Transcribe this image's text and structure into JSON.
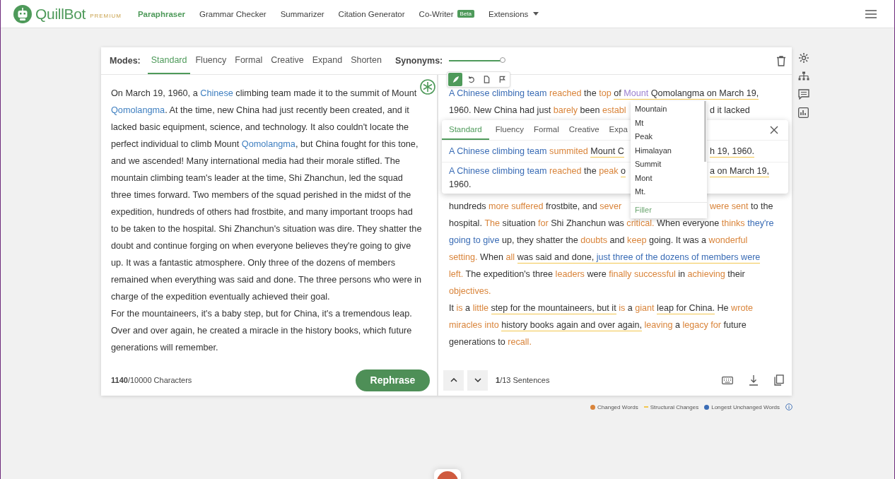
{
  "nav": {
    "brand": "QuillBot",
    "tier": "PREMIUM",
    "links": [
      {
        "label": "Paraphraser",
        "selected": true,
        "kind": "link"
      },
      {
        "label": "Grammar Checker",
        "selected": false,
        "kind": "link"
      },
      {
        "label": "Summarizer",
        "selected": false,
        "kind": "link"
      },
      {
        "label": "Citation Generator",
        "selected": false,
        "kind": "link"
      },
      {
        "label": "Co-Writer",
        "selected": false,
        "kind": "link",
        "badge": "Beta"
      },
      {
        "label": "Extensions",
        "selected": false,
        "kind": "menu"
      }
    ]
  },
  "modes": {
    "label": "Modes:",
    "tabs": [
      {
        "label": "Standard",
        "selected": true
      },
      {
        "label": "Fluency",
        "selected": false
      },
      {
        "label": "Formal",
        "selected": false
      },
      {
        "label": "Creative",
        "selected": false
      },
      {
        "label": "Expand",
        "selected": false
      },
      {
        "label": "Shorten",
        "selected": false
      }
    ]
  },
  "synonyms": {
    "label": "Synonyms:",
    "level": 1
  },
  "input": {
    "paragraphs": [
      [
        {
          "text": "On March 19, 1960, a ",
          "kind": "plain"
        },
        {
          "text": "Chinese",
          "kind": "frozen"
        },
        {
          "text": " climbing team made it to the summit of Mount ",
          "kind": "plain"
        },
        {
          "text": "Qomolangma",
          "kind": "frozen"
        },
        {
          "text": ". At the time, new China had just recently been created, and it lacked basic equipment, science, and technology. It also couldn't locate the perfect individual to climb Mount ",
          "kind": "plain"
        },
        {
          "text": "Qomolangma",
          "kind": "frozen"
        },
        {
          "text": ", but China fought for this tone, and we ascended! Many international media had their morale stifled. The mountain climbing team's leader at the time, Shi Zhanchun, led the squad three times forward. Two members of the squad perished in the midst of the expedition, hundreds of others had frostbite, and many important troops had to be taken to the hospital. Shi Zhanchun's situation was dire. They shatter the doubt and continue forging on when everyone believes they're going to give up. It was a fantastic atmosphere. Only three of the dozens of members remained when everything was said and done. The three persons who were in charge of the expedition eventually achieved their goal.",
          "kind": "plain"
        }
      ],
      [
        {
          "text": "For the mountaineers, it's a baby step, but for China, it's a tremendous leap. Over and over again, he created a miracle in the history books, which future generations will remember.",
          "kind": "plain"
        }
      ]
    ],
    "count": "**1140**/10000 Characters",
    "button": "Rephrase"
  },
  "toolbar": [
    {
      "kind": "quill",
      "selected": true
    },
    {
      "kind": "undo",
      "selected": false
    },
    {
      "kind": "copy",
      "selected": false
    },
    {
      "kind": "flag",
      "selected": false
    }
  ],
  "output": {
    "lines_top": [
      {
        "segments": [
          {
            "text": "A Chinese climbing team",
            "kind": "unchanged",
            "underline": false
          },
          {
            "text": " reached",
            "kind": "changed",
            "underline": false
          },
          {
            "text": " the ",
            "kind": "plain",
            "underline": false
          },
          {
            "text": "top ",
            "kind": "changed",
            "underline": false
          },
          {
            "text": "of ",
            "kind": "plain",
            "underline": true
          },
          {
            "text": "Mount",
            "kind": "active",
            "underline": true
          },
          {
            "text": " Qomolangma on March 19,",
            "kind": "plain",
            "underline": true
          }
        ]
      },
      {
        "segments": [
          {
            "text": "1960. New China had just ",
            "kind": "plain",
            "underline": false
          },
          {
            "text": "barely",
            "kind": "changed",
            "underline": false
          },
          {
            "text": " been ",
            "kind": "plain",
            "underline": false
          },
          {
            "text": "establ",
            "kind": "changed",
            "underline": false
          }
        ],
        "after_gap": [
          {
            "text": "d it lacked",
            "kind": "plain",
            "underline": false
          }
        ]
      }
    ],
    "lines_bottom": [
      {
        "segments": [
          {
            "text": "hundreds ",
            "kind": "plain",
            "underline": false
          },
          {
            "text": "more suffered",
            "kind": "changed",
            "underline": false
          },
          {
            "text": " frostbite, and ",
            "kind": "plain",
            "underline": false
          },
          {
            "text": "sever",
            "kind": "changed",
            "underline": false
          }
        ],
        "after_gap": [
          {
            "text": "were sent",
            "kind": "changed",
            "underline": false
          },
          {
            "text": " to the",
            "kind": "plain",
            "underline": false
          }
        ]
      },
      {
        "segments": [
          {
            "text": "hospital. ",
            "kind": "plain",
            "underline": false
          },
          {
            "text": "The",
            "kind": "changed",
            "underline": false
          },
          {
            "text": " situation ",
            "kind": "plain",
            "underline": false
          },
          {
            "text": "for",
            "kind": "changed",
            "underline": false
          },
          {
            "text": " Shi Zhanchun was ",
            "kind": "plain",
            "underline": false
          },
          {
            "text": "critical.",
            "kind": "changed",
            "underline": false
          },
          {
            "text": " When everyone ",
            "kind": "plain",
            "underline": false
          },
          {
            "text": "thinks",
            "kind": "changed",
            "underline": false
          },
          {
            "text": " they're",
            "kind": "unchanged",
            "underline": false
          }
        ]
      },
      {
        "segments": [
          {
            "text": "going to give",
            "kind": "unchanged",
            "underline": false
          },
          {
            "text": " up, they shatter the ",
            "kind": "plain",
            "underline": false
          },
          {
            "text": "doubts",
            "kind": "changed",
            "underline": false
          },
          {
            "text": " and ",
            "kind": "plain",
            "underline": false
          },
          {
            "text": "keep",
            "kind": "changed",
            "underline": false
          },
          {
            "text": " going. It was a ",
            "kind": "plain",
            "underline": false
          },
          {
            "text": "wonderful",
            "kind": "changed",
            "underline": false
          }
        ]
      },
      {
        "segments": [
          {
            "text": "setting.",
            "kind": "changed",
            "underline": false
          },
          {
            "text": " When ",
            "kind": "plain",
            "underline": false
          },
          {
            "text": "all ",
            "kind": "changed",
            "underline": false
          },
          {
            "text": "was said and done,",
            "kind": "plain",
            "underline": true
          },
          {
            "text": " just three of the dozens of members were",
            "kind": "unchanged",
            "underline": true
          }
        ]
      },
      {
        "segments": [
          {
            "text": "left.",
            "kind": "changed",
            "underline": false
          },
          {
            "text": " The expedition's three ",
            "kind": "plain",
            "underline": false
          },
          {
            "text": "leaders",
            "kind": "changed",
            "underline": false
          },
          {
            "text": " were ",
            "kind": "plain",
            "underline": false
          },
          {
            "text": "finally successful",
            "kind": "changed",
            "underline": false
          },
          {
            "text": " in ",
            "kind": "plain",
            "underline": false
          },
          {
            "text": "achieving",
            "kind": "changed",
            "underline": false
          },
          {
            "text": " their",
            "kind": "plain",
            "underline": false
          }
        ]
      },
      {
        "segments": [
          {
            "text": "objectives.",
            "kind": "changed",
            "underline": false
          }
        ]
      },
      {
        "segments": [
          {
            "text": "It ",
            "kind": "plain",
            "underline": false
          },
          {
            "text": "is",
            "kind": "changed",
            "underline": false
          },
          {
            "text": " a ",
            "kind": "plain",
            "underline": false
          },
          {
            "text": "little ",
            "kind": "changed",
            "underline": false
          },
          {
            "text": "step for the mountaineers, but it",
            "kind": "plain",
            "underline": true
          },
          {
            "text": " is",
            "kind": "changed",
            "underline": false
          },
          {
            "text": " a ",
            "kind": "plain",
            "underline": false
          },
          {
            "text": "giant ",
            "kind": "changed",
            "underline": false
          },
          {
            "text": "leap for China.",
            "kind": "plain",
            "underline": true
          },
          {
            "text": " He ",
            "kind": "plain",
            "underline": false
          },
          {
            "text": "wrote",
            "kind": "changed",
            "underline": false
          }
        ]
      },
      {
        "segments": [
          {
            "text": "miracles into ",
            "kind": "changed",
            "underline": false
          },
          {
            "text": "history books again and over again,",
            "kind": "plain",
            "underline": true
          },
          {
            "text": " leaving",
            "kind": "changed",
            "underline": false
          },
          {
            "text": " a ",
            "kind": "plain",
            "underline": false
          },
          {
            "text": "legacy for",
            "kind": "changed",
            "underline": false
          },
          {
            "text": " future",
            "kind": "plain",
            "underline": false
          }
        ]
      },
      {
        "segments": [
          {
            "text": "generations to ",
            "kind": "plain",
            "underline": false
          },
          {
            "text": "recall.",
            "kind": "changed",
            "underline": false
          }
        ]
      }
    ],
    "count": "**1**/13 Sentences"
  },
  "alternatives": {
    "tabs": [
      {
        "label": "Standard",
        "selected": true
      },
      {
        "label": "Fluency",
        "selected": false
      },
      {
        "label": "Formal",
        "selected": false
      },
      {
        "label": "Creative",
        "selected": false
      },
      {
        "label": "Expa",
        "selected": false
      }
    ],
    "options": [
      {
        "lines": [
          {
            "segments": [
              {
                "text": "A Chinese climbing team",
                "kind": "unchanged",
                "underline": false
              },
              {
                "text": " summited ",
                "kind": "changed",
                "underline": false
              },
              {
                "text": "Mount C",
                "kind": "plain",
                "underline": true
              }
            ],
            "after_gap": [
              {
                "text": "h 19, 1960.",
                "kind": "plain",
                "underline": true
              }
            ]
          }
        ]
      },
      {
        "lines": [
          {
            "segments": [
              {
                "text": "A Chinese climbing team",
                "kind": "unchanged",
                "underline": false
              },
              {
                "text": " reached",
                "kind": "changed",
                "underline": false
              },
              {
                "text": " the ",
                "kind": "plain",
                "underline": false
              },
              {
                "text": "peak ",
                "kind": "changed",
                "underline": false
              },
              {
                "text": "o",
                "kind": "plain",
                "underline": true
              }
            ],
            "after_gap": [
              {
                "text": "a on March 19,",
                "kind": "plain",
                "underline": true
              }
            ]
          },
          {
            "segments": [
              {
                "text": "1960.",
                "kind": "plain",
                "underline": false
              }
            ]
          }
        ]
      }
    ]
  },
  "synonym_menu": {
    "options": [
      "Mountain",
      "Mt",
      "Peak",
      "Himalayan",
      "Summit",
      "Mont",
      "Mt."
    ],
    "footer": "Filler"
  },
  "legend": [
    {
      "label": "Changed Words",
      "color": "#d9843a",
      "kind": "dot"
    },
    {
      "label": "Structural Changes",
      "color": "#f2c64e",
      "kind": "dash"
    },
    {
      "label": "Longest Unchanged Words",
      "color": "#3a6cb5",
      "kind": "dot"
    }
  ]
}
